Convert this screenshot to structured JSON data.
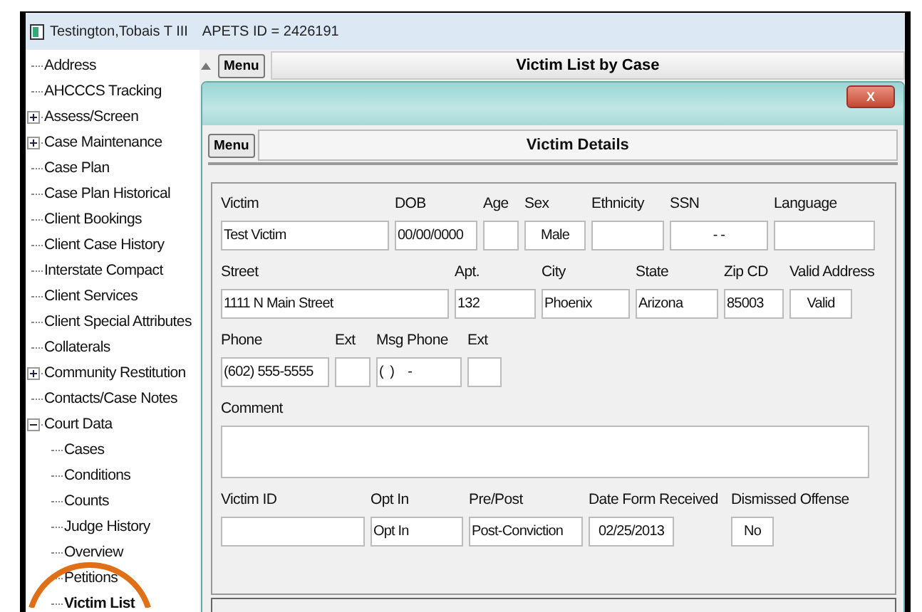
{
  "window": {
    "title": "Testington,Tobais T III",
    "id_label": "APETS ID = 2426191"
  },
  "tree": [
    {
      "label": "Address",
      "selected": false
    },
    {
      "label": "AHCCCS Tracking",
      "selected": false
    },
    {
      "label": "Assess/Screen",
      "selected": false,
      "expanded": false
    },
    {
      "label": "Case Maintenance",
      "selected": false,
      "expanded": false
    },
    {
      "label": "Case Plan",
      "selected": false
    },
    {
      "label": "Case Plan Historical",
      "selected": false
    },
    {
      "label": "Client Bookings",
      "selected": false
    },
    {
      "label": "Client Case History",
      "selected": false
    },
    {
      "label": "Interstate Compact",
      "selected": false
    },
    {
      "label": "Client Services",
      "selected": false
    },
    {
      "label": "Client Special Attributes",
      "selected": false
    },
    {
      "label": "Collaterals",
      "selected": false
    },
    {
      "label": "Community Restitution",
      "selected": false,
      "expanded": false
    },
    {
      "label": "Contacts/Case Notes",
      "selected": false
    },
    {
      "label": "Court Data",
      "selected": false,
      "expanded": true,
      "children": [
        {
          "label": "Cases",
          "selected": false
        },
        {
          "label": "Conditions",
          "selected": false
        },
        {
          "label": "Counts",
          "selected": false
        },
        {
          "label": "Judge History",
          "selected": false
        },
        {
          "label": "Overview",
          "selected": false
        },
        {
          "label": "Petitions",
          "selected": false
        },
        {
          "label": "Victim List",
          "selected": true
        }
      ]
    }
  ],
  "outer_panel": {
    "menu_button": "Menu",
    "title": "Victim List by Case"
  },
  "dialog": {
    "close": "X",
    "menu_button": "Menu",
    "title": "Victim Details",
    "rows": [
      {
        "fields": [
          {
            "label": "Victim",
            "value": "Test Victim",
            "centered": false
          },
          {
            "label": "DOB",
            "value": "00/00/0000",
            "centered": false
          },
          {
            "label": "Age"
          },
          {
            "label": "Sex",
            "value": "Male",
            "centered": true
          },
          {
            "label": "Ethnicity"
          },
          {
            "label": "SSN",
            "value": "- -",
            "centered": true
          },
          {
            "label": "Language"
          }
        ]
      },
      {
        "fields": [
          {
            "label": "Street",
            "value": "1111 N Main Street",
            "centered": false
          },
          {
            "label": "Apt.",
            "value": "132",
            "centered": false
          },
          {
            "label": "City",
            "value": "Phoenix",
            "centered": false
          },
          {
            "label": "State",
            "value": "Arizona",
            "centered": false
          },
          {
            "label": "Zip CD",
            "value": "85003",
            "centered": false
          },
          {
            "label": "Valid Address",
            "value": "Valid",
            "centered": true
          }
        ]
      },
      {
        "fields": [
          {
            "label": "Phone",
            "value": "(602) 555-5555",
            "centered": false
          },
          {
            "label": "Ext"
          },
          {
            "label": "Msg Phone",
            "value": "(  )    -",
            "centered": false
          },
          {
            "label": "Ext"
          }
        ]
      },
      {
        "fields": [
          {
            "label": "Comment"
          }
        ]
      },
      {
        "fields": [
          {
            "label": "Victim ID"
          },
          {
            "label": "Opt In",
            "value": "Opt In",
            "centered": false
          },
          {
            "label": "Pre/Post",
            "value": "Post-Conviction",
            "centered": false
          },
          {
            "label": "Date Form Received",
            "value": "02/25/2013",
            "centered": true
          },
          {
            "label": "Dismissed Offense",
            "value": "No",
            "centered": true
          }
        ]
      }
    ]
  }
}
